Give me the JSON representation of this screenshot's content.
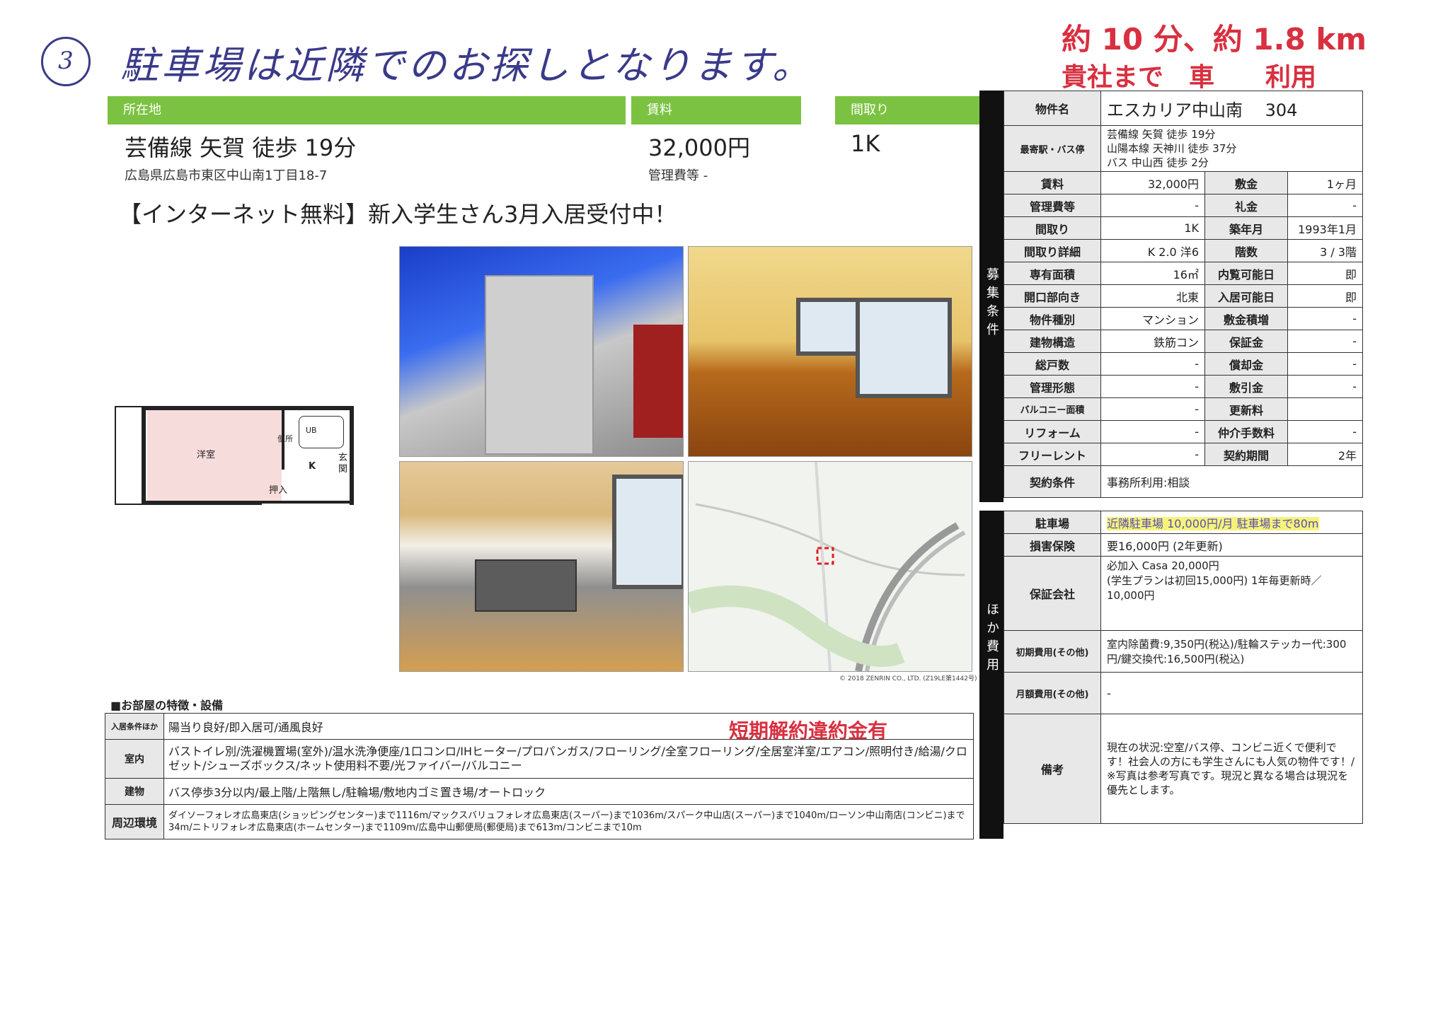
{
  "handwritten": {
    "circle_number": "3",
    "note": "駐車場は近隣でのお探しとなります。",
    "top_right_1": "約 10 分、約 1.8 km",
    "top_right_2": "貴社まで　車　　利用"
  },
  "summary": {
    "location_label": "所在地",
    "rent_label": "賃料",
    "layout_label": "間取り",
    "access": "芸備線 矢賀 徒歩 19分",
    "address": "広島県広島市東区中山南1丁目18-7",
    "rent": "32,000円",
    "management_fee": "管理費等 -",
    "layout": "1K",
    "headline": "【インターネット無料】新入学生さん3月入居受付中！"
  },
  "floor_plan": {
    "western_room": "洋室",
    "toilet": "便所",
    "unit_bath": "UB",
    "kitchen": "K",
    "entrance": "玄関",
    "closet": "押入"
  },
  "map_credit": "© 2018 ZENRIN CO., LTD. (Z19LE第1442号)",
  "spec": {
    "side_label_1": "募集条件",
    "side_label_2": "ほか費用",
    "property_name_label": "物件名",
    "property_name": "エスカリア中山南　 304",
    "station_label": "最寄駅・バス停",
    "station_lines": [
      "芸備線 矢賀 徒歩 19分",
      "山陽本線 天神川 徒歩 37分",
      "バス 中山西 徒歩 2分"
    ],
    "rows": [
      {
        "l1": "賃料",
        "v1": "32,000円",
        "l2": "敷金",
        "v2": "1ヶ月"
      },
      {
        "l1": "管理費等",
        "v1": "-",
        "l2": "礼金",
        "v2": "-"
      },
      {
        "l1": "間取り",
        "v1": "1K",
        "l2": "築年月",
        "v2": "1993年1月"
      },
      {
        "l1": "間取り詳細",
        "v1": "K 2.0 洋6",
        "l2": "階数",
        "v2": "3 / 3階"
      },
      {
        "l1": "専有面積",
        "v1": "16㎡",
        "l2": "内覧可能日",
        "v2": "即"
      },
      {
        "l1": "開口部向き",
        "v1": "北東",
        "l2": "入居可能日",
        "v2": "即"
      },
      {
        "l1": "物件種別",
        "v1": "マンション",
        "l2": "敷金積増",
        "v2": "-"
      },
      {
        "l1": "建物構造",
        "v1": "鉄筋コン",
        "l2": "保証金",
        "v2": "-"
      },
      {
        "l1": "総戸数",
        "v1": "-",
        "l2": "償却金",
        "v2": "-"
      },
      {
        "l1": "管理形態",
        "v1": "-",
        "l2": "敷引金",
        "v2": "-"
      },
      {
        "l1": "バルコニー面積",
        "v1": "-",
        "l2": "更新料",
        "v2": ""
      },
      {
        "l1": "リフォーム",
        "v1": "-",
        "l2": "仲介手数料",
        "v2": "-"
      },
      {
        "l1": "フリーレント",
        "v1": "-",
        "l2": "契約期間",
        "v2": "2年"
      }
    ],
    "contract_label": "契約条件",
    "contract": "事務所利用:相談",
    "parking_label": "駐車場",
    "parking": "近隣駐車場 10,000円/月 駐車場まで80m",
    "insurance_label": "損害保険",
    "insurance": "要16,000円 (2年更新)",
    "guarantor_label": "保証会社",
    "guarantor_1": "必加入 Casa 20,000円",
    "guarantor_2": "(学生プランは初回15,000円) 1年毎更新時／10,000円",
    "initial_label": "初期費用(その他)",
    "initial": "室内除菌費:9,350円(税込)/駐輪ステッカー代:300円/鍵交換代:16,500円(税込)",
    "monthly_label": "月額費用(その他)",
    "monthly": "-",
    "remarks_label": "備考",
    "remarks": "現在の状況:空室/バス停、コンビニ近くで便利です！社会人の方にも学生さんにも人気の物件です！/※写真は参考写真です。現況と異なる場合は現況を優先とします。"
  },
  "features": {
    "section_title": "■お部屋の特徴・設備",
    "stamp": "短期解約違約金有",
    "rows": [
      {
        "label": "入居条件ほか",
        "value": "陽当り良好/即入居可/通風良好"
      },
      {
        "label": "室内",
        "value": "バストイレ別/洗濯機置場(室外)/温水洗浄便座/1口コンロ/IHヒーター/プロパンガス/フローリング/全室フローリング/全居室洋室/エアコン/照明付き/給湯/クロゼット/シューズボックス/ネット使用料不要/光ファイバー/バルコニー"
      },
      {
        "label": "建物",
        "value": "バス停歩3分以内/最上階/上階無し/駐輪場/敷地内ゴミ置き場/オートロック"
      },
      {
        "label": "周辺環境",
        "value": "ダイソーフォレオ広島東店(ショッピングセンター)まで1116m/マックスバリュフォレオ広島東店(スーパー)まで1036m/スパーク中山店(スーパー)まで1040m/ローソン中山南店(コンビニ)まで34m/ニトリフォレオ広島東店(ホームセンター)まで1109m/広島中山郵便局(郵便局)まで613m/コンビニまで10m"
      }
    ]
  }
}
